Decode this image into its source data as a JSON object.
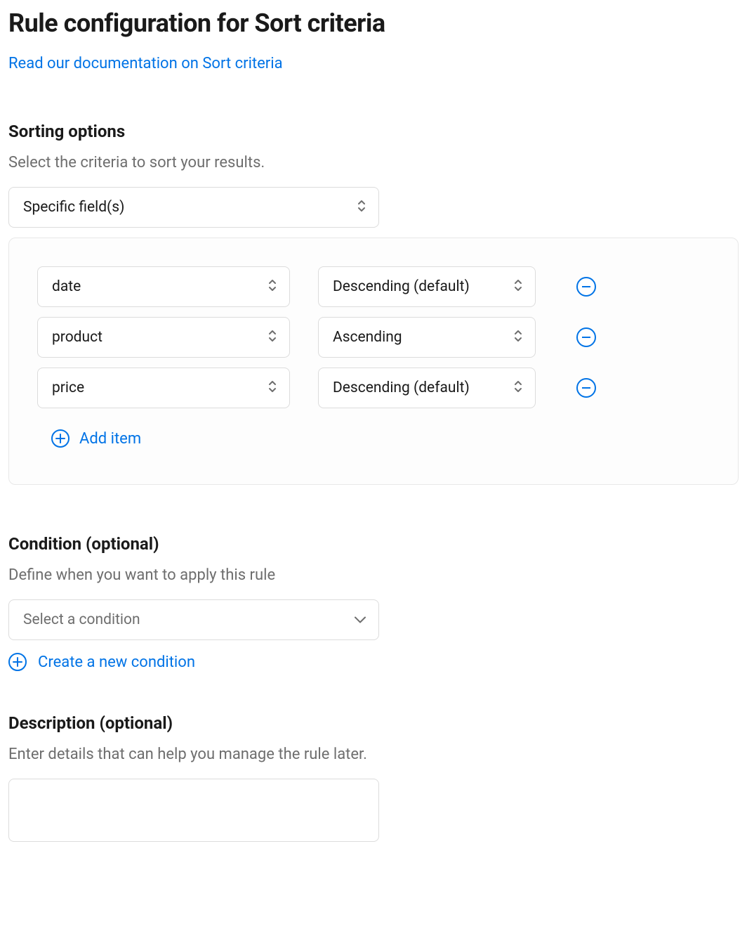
{
  "header": {
    "title": "Rule configuration for Sort criteria",
    "doc_link": "Read our documentation on Sort criteria"
  },
  "sorting": {
    "heading": "Sorting options",
    "helper": "Select the criteria to sort your results.",
    "criteria_select": "Specific field(s)",
    "rows": [
      {
        "field": "date",
        "direction": "Descending (default)"
      },
      {
        "field": "product",
        "direction": "Ascending"
      },
      {
        "field": "price",
        "direction": "Descending (default)"
      }
    ],
    "add_item_label": "Add item"
  },
  "condition": {
    "heading": "Condition (optional)",
    "helper": "Define when you want to apply this rule",
    "select_placeholder": "Select a condition",
    "create_label": "Create a new condition"
  },
  "description": {
    "heading": "Description (optional)",
    "helper": "Enter details that can help you manage the rule later.",
    "value": ""
  }
}
